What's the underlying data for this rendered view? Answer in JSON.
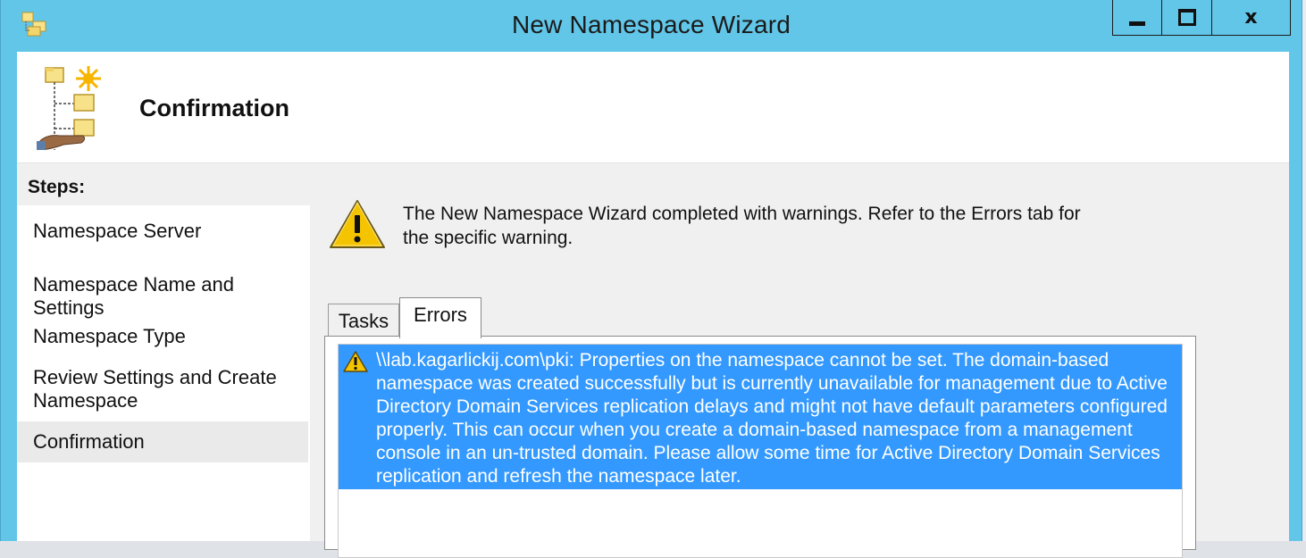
{
  "window": {
    "title": "New Namespace Wizard",
    "controls": {
      "minimize": "minimize",
      "maximize": "maximize",
      "close": "x"
    }
  },
  "header": {
    "title": "Confirmation"
  },
  "steps": {
    "heading": "Steps:",
    "items": [
      {
        "label": "Namespace Server"
      },
      {
        "label": "Namespace Name and Settings"
      },
      {
        "label": "Namespace Type"
      },
      {
        "label": "Review Settings and Create\nNamespace"
      },
      {
        "label": "Confirmation",
        "active": true
      }
    ]
  },
  "status": {
    "icon": "warning-icon",
    "message": "The New Namespace Wizard completed with warnings. Refer to the Errors tab for the specific warning."
  },
  "tabs": [
    {
      "label": "Tasks",
      "selected": false
    },
    {
      "label": "Errors",
      "selected": true
    }
  ],
  "errors": [
    {
      "icon": "warning-icon",
      "text": "\\\\lab.kagarlickij.com\\pki: Properties on the namespace cannot be set. The domain-based namespace was created successfully but is currently unavailable for management due to Active Directory Domain Services replication delays and might not have default parameters configured properly. This can occur when you create a domain-based namespace from a management console in an un-trusted domain. Please allow some time for Active Directory Domain Services replication and refresh the namespace later.",
      "selected": true
    }
  ],
  "colors": {
    "titlebar": "#62c6e8",
    "selection": "#3399ff",
    "warning_yellow": "#f5c400"
  }
}
